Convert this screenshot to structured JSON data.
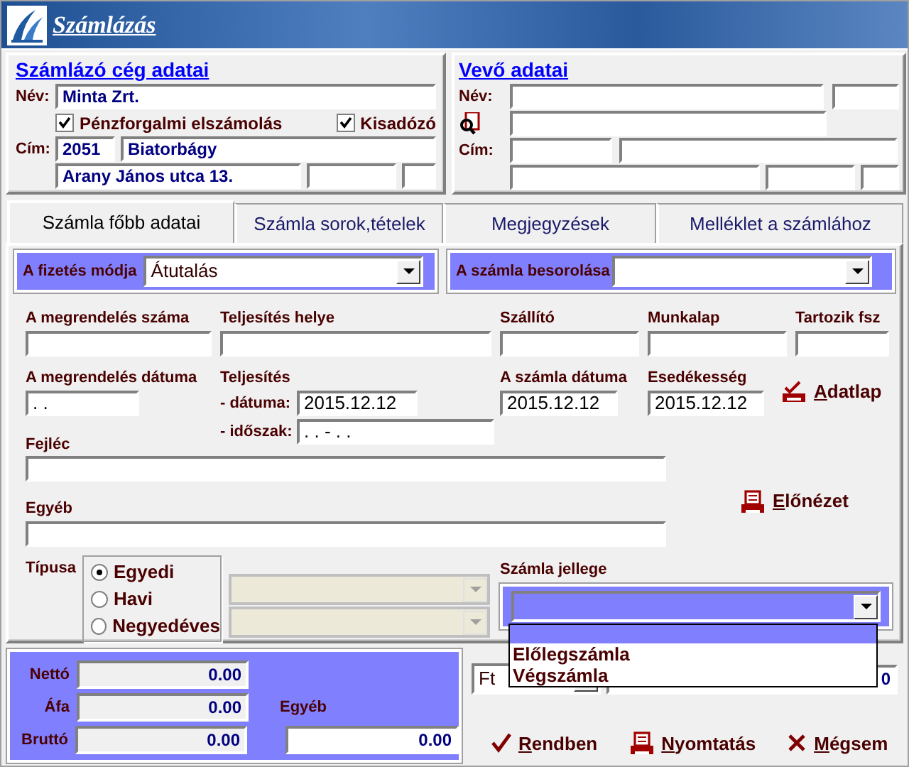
{
  "window": {
    "title": "Számlázás"
  },
  "issuer": {
    "heading": "Számlázó cég adatai",
    "name_label": "Név:",
    "name": "Minta Zrt.",
    "address_label": "Cím:",
    "zip": "2051",
    "city": "Biatorbágy",
    "street": "Arany János utca 13.",
    "options": [
      {
        "label": "Pénzforgalmi elszámolás",
        "checked": true
      },
      {
        "label": "Kisadózó",
        "checked": true
      }
    ]
  },
  "buyer": {
    "heading": "Vevő adatai",
    "name_label": "Név:",
    "address_label": "Cím:"
  },
  "tabs": [
    {
      "label": "Számla főbb adatai",
      "selected": true
    },
    {
      "label": "Számla sorok,tételek",
      "selected": false
    },
    {
      "label": "Megjegyzések",
      "selected": false
    },
    {
      "label": "Melléklet a számlához",
      "selected": false
    }
  ],
  "payment_method": {
    "label": "A fizetés módja",
    "value": "Átutalás"
  },
  "classification": {
    "label": "A számla besorolása"
  },
  "order_number": {
    "label": "A megrendelés száma"
  },
  "fulfilment_place": {
    "label": "Teljesítés helye"
  },
  "supplier": {
    "label": "Szállító"
  },
  "worksheet": {
    "label": "Munkalap"
  },
  "belongs_to": {
    "label": "Tartozik fsz"
  },
  "order_date": {
    "label": "A megrendelés dátuma",
    "value": ". ."
  },
  "fulfilment": {
    "label": "Teljesítés",
    "date_label": "- dátuma:",
    "date": "2015.12.12",
    "period_label": "- időszak:",
    "period": ". . - . ."
  },
  "invoice_date": {
    "label": "A számla dátuma",
    "value": "2015.12.12"
  },
  "due_date": {
    "label": "Esedékesség",
    "value": "2015.12.12"
  },
  "datasheet_button": "Adatlap",
  "header_text": {
    "label": "Fejléc"
  },
  "other_text": {
    "label": "Egyéb"
  },
  "preview_button": "Előnézet",
  "type": {
    "label": "Típusa",
    "options": [
      {
        "label": "Egyedi",
        "selected": true
      },
      {
        "label": "Havi",
        "selected": false
      },
      {
        "label": "Negyedéves",
        "selected": false
      }
    ]
  },
  "invoice_character": {
    "label": "Számla jellege",
    "expanded": true,
    "options": [
      {
        "label": "Előlegszámla",
        "selected": false
      },
      {
        "label": "Végszámla",
        "selected": false
      }
    ]
  },
  "totals": {
    "net_label": "Nettó",
    "net": "0.00",
    "vat_label": "Áfa",
    "vat": "0.00",
    "gross_label": "Bruttó",
    "gross": "0.00",
    "other_label": "Egyéb",
    "other": "0.00"
  },
  "currency": "Ft",
  "amount_field": "0",
  "buttons": [
    {
      "label": "Rendben",
      "kind": "ok"
    },
    {
      "label": "Nyomtatás",
      "kind": "print"
    },
    {
      "label": "Mégsem",
      "kind": "cancel"
    }
  ]
}
